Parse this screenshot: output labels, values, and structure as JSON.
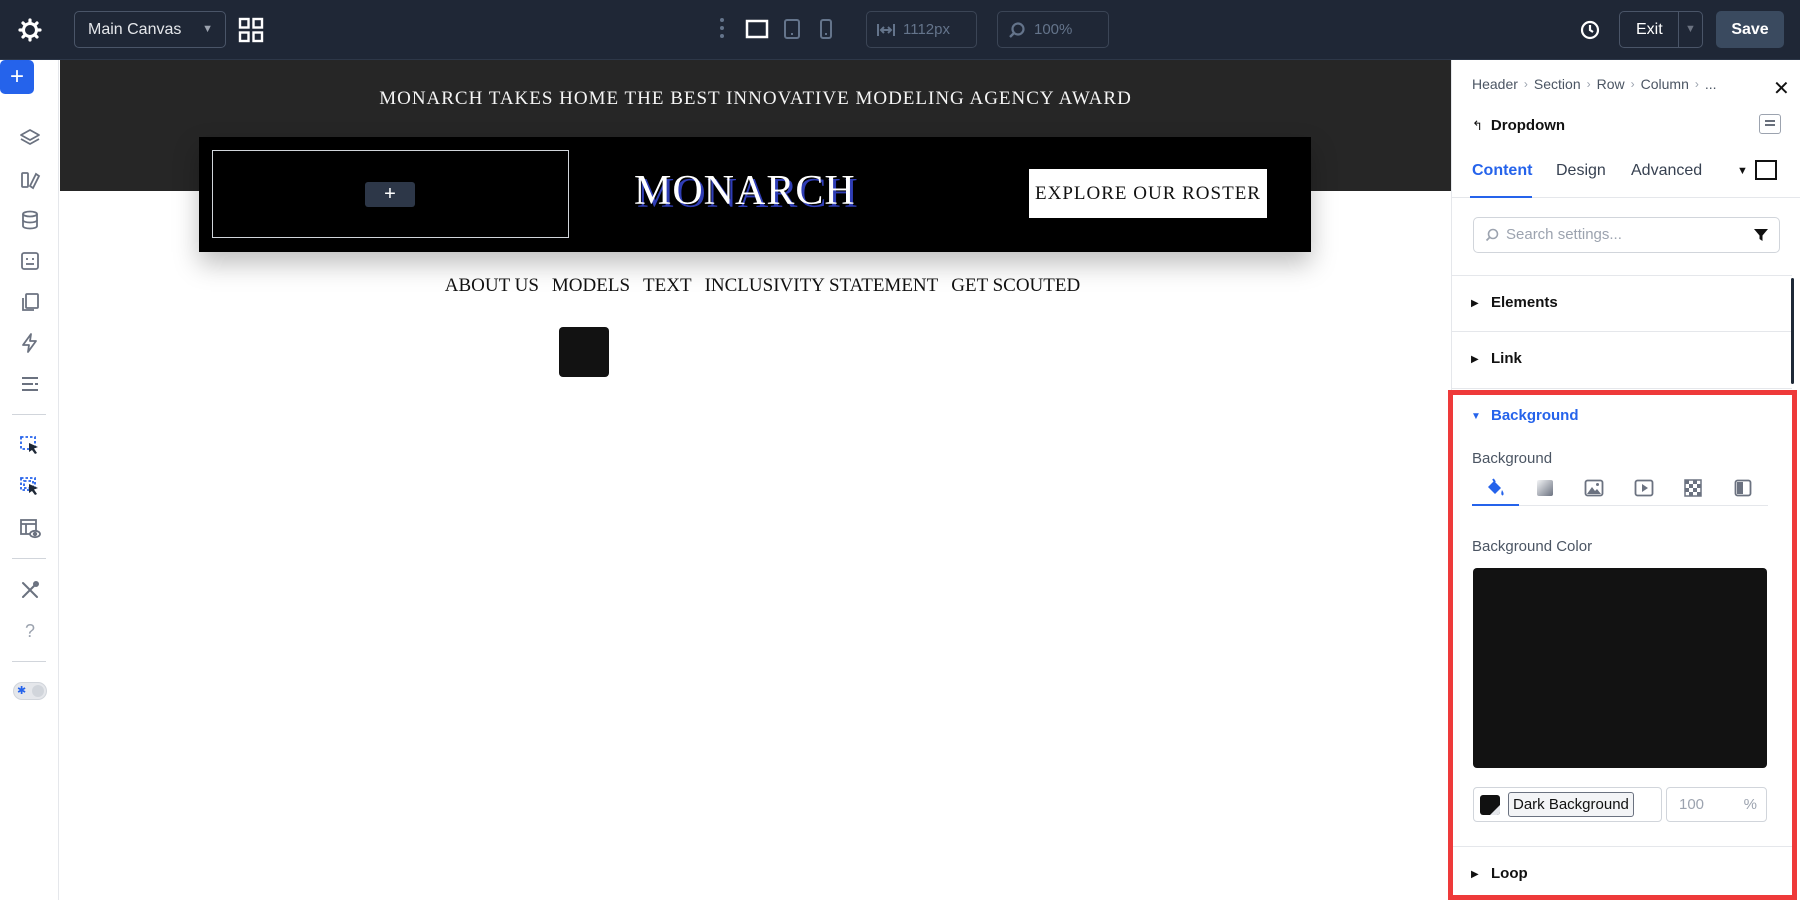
{
  "topbar": {
    "canvas_select": "Main Canvas",
    "width_value": "1112px",
    "zoom_value": "100%",
    "exit_label": "Exit",
    "save_label": "Save"
  },
  "canvas": {
    "announcement": "MONARCH TAKES HOME THE BEST INNOVATIVE MODELING AGENCY AWARD",
    "logo": "MONARCH",
    "cta": "EXPLORE OUR ROSTER",
    "add_module": "+",
    "menu": [
      "ABOUT US",
      "MODELS",
      "TEXT",
      "INCLUSIVITY STATEMENT",
      "GET SCOUTED"
    ],
    "accent_color": "#2f3db5"
  },
  "panel": {
    "breadcrumbs": [
      "Header",
      "Section",
      "Row",
      "Column",
      "..."
    ],
    "module_title": "Dropdown",
    "tabs": [
      "Content",
      "Design",
      "Advanced"
    ],
    "search_placeholder": "Search settings...",
    "sections": [
      "Elements",
      "Link",
      "Background",
      "Loop"
    ],
    "background": {
      "sub_label": "Background",
      "color_label": "Background Color",
      "color_name": "Dark Background",
      "color_value": "#121212",
      "opacity": "100",
      "opacity_unit": "%"
    }
  },
  "colors": {
    "accent": "#2563eb",
    "topbar": "#1f2736",
    "highlight": "#ee3a3a"
  }
}
